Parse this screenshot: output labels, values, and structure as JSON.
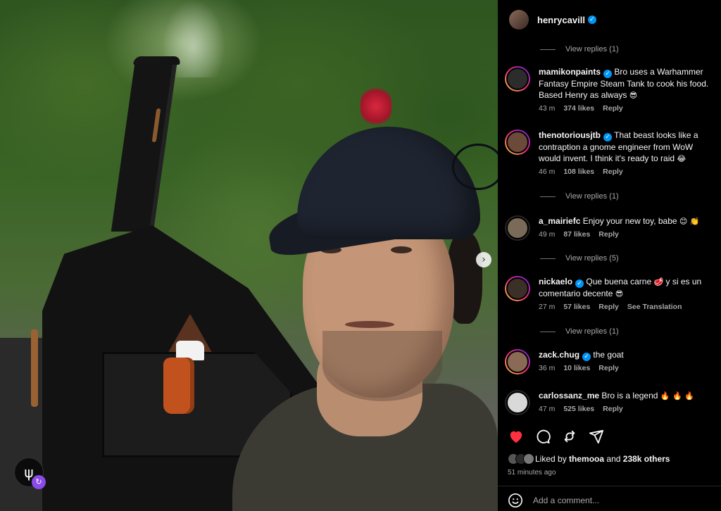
{
  "post": {
    "author": "henrycavill"
  },
  "comments": [
    {
      "username": "mamikonpaints",
      "text": "Bro uses a Warhammer Fantasy Empire Steam Tank to cook his food. Based Henry as always",
      "emoji": "😎",
      "time": "43 m",
      "likes": "374 likes",
      "reply": "Reply"
    },
    {
      "username": "thenotoriousjtb",
      "text": "That beast looks like a contraption a gnome engineer from WoW would invent. I think it's ready to raid",
      "emoji": "😂",
      "time": "46 m",
      "likes": "108 likes",
      "reply": "Reply"
    },
    {
      "username": "a_mairiefc",
      "text": "Enjoy your new toy, babe",
      "emoji": "😊 👏",
      "time": "49 m",
      "likes": "87 likes",
      "reply": "Reply"
    },
    {
      "username": "nickaelo",
      "text": "Que buena carne",
      "text2": "y si es un comentario decente",
      "emoji": "🥩",
      "emoji2": "😎",
      "time": "27 m",
      "likes": "57 likes",
      "reply": "Reply",
      "see_translation": "See Translation"
    },
    {
      "username": "zack.chug",
      "text": "the goat",
      "time": "36 m",
      "likes": "10 likes",
      "reply": "Reply"
    },
    {
      "username": "carlossanz_me",
      "text": "Bro is a legend",
      "emoji": "🔥 🔥 🔥",
      "time": "47 m",
      "likes": "525 likes",
      "reply": "Reply"
    }
  ],
  "view_replies": [
    "View replies (1)",
    "View replies (1)",
    "View replies (5)",
    "View replies (1)"
  ],
  "liked_by": {
    "prefix": "Liked by",
    "user": "themooa",
    "and": "and",
    "others": "238k others"
  },
  "posted_time": "51 minutes ago",
  "add_comment_placeholder": "Add a comment...",
  "colors": {
    "heart": "#ff3040",
    "verified": "#0095f6",
    "panel_bg": "#000000",
    "muted_text": "#a8a8a8"
  },
  "icons": {
    "like": "heart-icon",
    "comment": "comment-icon",
    "repost": "repost-icon",
    "share": "send-icon",
    "emoji": "smile-icon",
    "carousel_next": "chevron-right-icon"
  }
}
